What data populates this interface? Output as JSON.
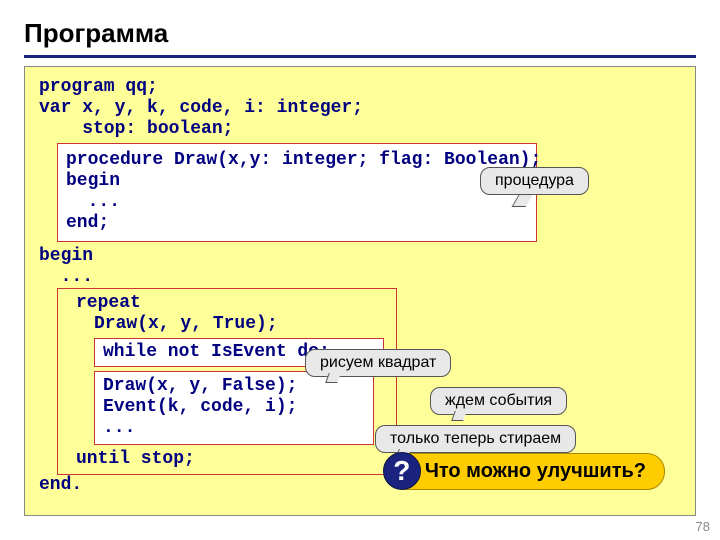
{
  "title": "Программа",
  "code": {
    "l1": "program qq;",
    "l2": "var x, y, k, code, i: integer;",
    "l3": "    stop: boolean;",
    "proc": "procedure Draw(x,y: integer; flag: Boolean);\nbegin\n  ...\nend;",
    "l4": "begin",
    "l5": "  ...",
    "repeat_kw": "repeat",
    "draw_true": "Draw(x, y, True);",
    "while_line": "while not IsEvent do;",
    "draw_false": "Draw(x, y, False);\nEvent(k, code, i);\n...",
    "until_kw": "until stop;",
    "l6": "end."
  },
  "callouts": {
    "proc": "процедура",
    "draw": "рисуем квадрат",
    "wait": "ждем события",
    "erase": "только теперь стираем"
  },
  "improve": "Что можно улучшить?",
  "qmark": "?",
  "page": "78"
}
